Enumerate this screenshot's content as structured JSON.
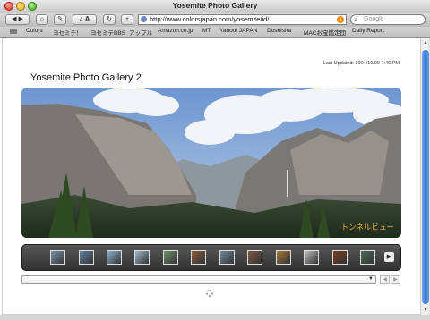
{
  "window": {
    "title": "Yosemite Photo Gallery"
  },
  "toolbar": {
    "back_icon": "back-arrow-icon",
    "forward_icon": "forward-arrow-icon",
    "home_icon": "home-icon",
    "edit_icon": "pencil-icon",
    "text_smaller": "A",
    "text_larger": "A",
    "reload_icon": "reload-icon",
    "add_icon": "plus-icon",
    "url": "http://www.colorsjapan.com/yosemite/id/",
    "rss_icon": "rss-icon",
    "search_placeholder": "Google"
  },
  "bookmarks": [
    "Colors",
    "ヨセミテ！",
    "ヨセミテBBS",
    "アップル",
    "Amazon.co.jp",
    "MT",
    "Yahoo! JAPAN",
    "Doshisha",
    "MACお宝鑑定団",
    "Daily Report"
  ],
  "page": {
    "last_updated": "Last Updated: 2004/10/09 7:46 PM",
    "title": "Yosemite Photo Gallery 2",
    "photo_caption": "トンネルビュー"
  },
  "colors": {
    "caption": "#f3b23a",
    "scrollbar": "#3b79db",
    "strip": "#3d3d3d"
  },
  "thumbnails": [
    {
      "name": "thumb-1",
      "color": "#7d93a8"
    },
    {
      "name": "thumb-2",
      "color": "#5e7fa3"
    },
    {
      "name": "thumb-3",
      "color": "#8fb0cf"
    },
    {
      "name": "thumb-4",
      "color": "#9fb7c9"
    },
    {
      "name": "thumb-5",
      "color": "#6f8d6a"
    },
    {
      "name": "thumb-6",
      "color": "#8b5a3c"
    },
    {
      "name": "thumb-7",
      "color": "#6f88a0"
    },
    {
      "name": "thumb-8",
      "color": "#7d5a45"
    },
    {
      "name": "thumb-9",
      "color": "#a8783e"
    },
    {
      "name": "thumb-10",
      "color": "#bdbdbd"
    },
    {
      "name": "thumb-11",
      "color": "#7a3d1f"
    },
    {
      "name": "thumb-12",
      "color": "#4e6b55"
    }
  ]
}
